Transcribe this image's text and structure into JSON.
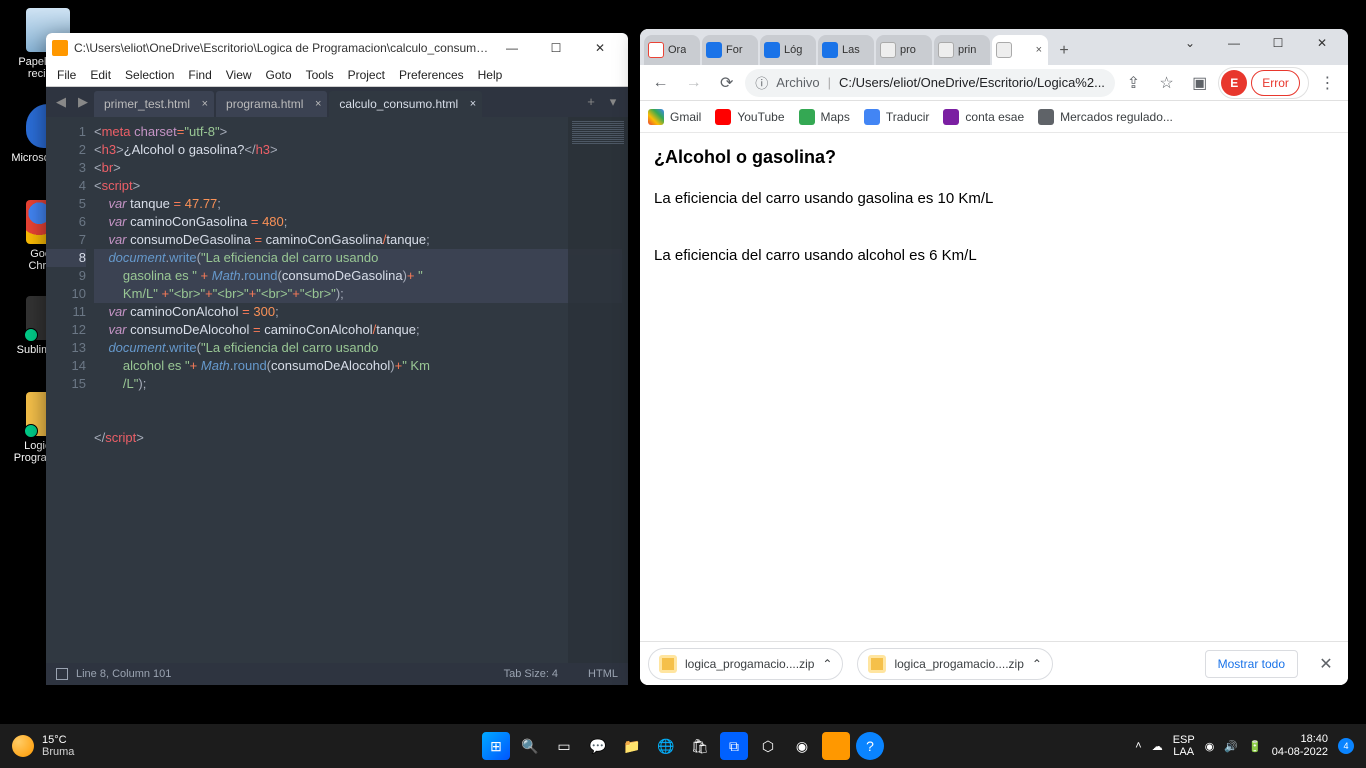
{
  "desktop": {
    "icons": [
      {
        "label": "Papelera de reciclaje"
      },
      {
        "label": "Microsoft Edge"
      },
      {
        "label": "Google Chrome"
      },
      {
        "label": "Sublime Text"
      },
      {
        "label": "Logica de Programacion"
      }
    ]
  },
  "sublime": {
    "title": "C:\\Users\\eliot\\OneDrive\\Escritorio\\Logica de Programacion\\calculo_consumo...",
    "menu": [
      "File",
      "Edit",
      "Selection",
      "Find",
      "View",
      "Goto",
      "Tools",
      "Project",
      "Preferences",
      "Help"
    ],
    "tabs": [
      {
        "label": "primer_test.html",
        "active": false
      },
      {
        "label": "programa.html",
        "active": false
      },
      {
        "label": "calculo_consumo.html",
        "active": true
      }
    ],
    "lines": [
      "1",
      "2",
      "3",
      "4",
      "5",
      "6",
      "7",
      "8",
      "9",
      "10",
      "11",
      "12",
      "13",
      "14",
      "15"
    ],
    "highlighted_line_index": 7,
    "status": {
      "cursor": "Line 8, Column 101",
      "tab": "Tab Size: 4",
      "lang": "HTML"
    }
  },
  "chrome": {
    "tabs": [
      {
        "label": "Ora",
        "favicon": "#ea4335"
      },
      {
        "label": "For",
        "favicon": "#1a73e8"
      },
      {
        "label": "Lóg",
        "favicon": "#1a73e8"
      },
      {
        "label": "Las",
        "favicon": "#1a73e8"
      },
      {
        "label": "pro",
        "favicon": "#9aa0a6"
      },
      {
        "label": "prin",
        "favicon": "#9aa0a6"
      },
      {
        "label": "",
        "favicon": "#9aa0a6",
        "active": true
      }
    ],
    "url_scheme": "Archivo",
    "url_path": "C:/Users/eliot/OneDrive/Escritorio/Logica%2...",
    "error_label": "Error",
    "avatar_letter": "E",
    "bookmarks": [
      {
        "label": "Gmail",
        "color": "#ea4335"
      },
      {
        "label": "YouTube",
        "color": "#ff0000"
      },
      {
        "label": "Maps",
        "color": "#34a853"
      },
      {
        "label": "Traducir",
        "color": "#4285f4"
      },
      {
        "label": "conta esae",
        "color": "#7b1fa2"
      },
      {
        "label": "Mercados regulado...",
        "color": "#5f6368"
      }
    ],
    "page": {
      "heading": "¿Alcohol o gasolina?",
      "line1": "La eficiencia del carro usando gasolina es 10 Km/L",
      "line2": "La eficiencia del carro usando alcohol es 6 Km/L"
    },
    "downloads": {
      "items": [
        {
          "label": "logica_progamacio....zip"
        },
        {
          "label": "logica_progamacio....zip"
        }
      ],
      "showall": "Mostrar todo"
    }
  },
  "taskbar": {
    "weather": {
      "temp": "15°C",
      "cond": "Bruma"
    },
    "lang1": "ESP",
    "lang2": "LAA",
    "time": "18:40",
    "date": "04-08-2022",
    "notif": "4"
  }
}
